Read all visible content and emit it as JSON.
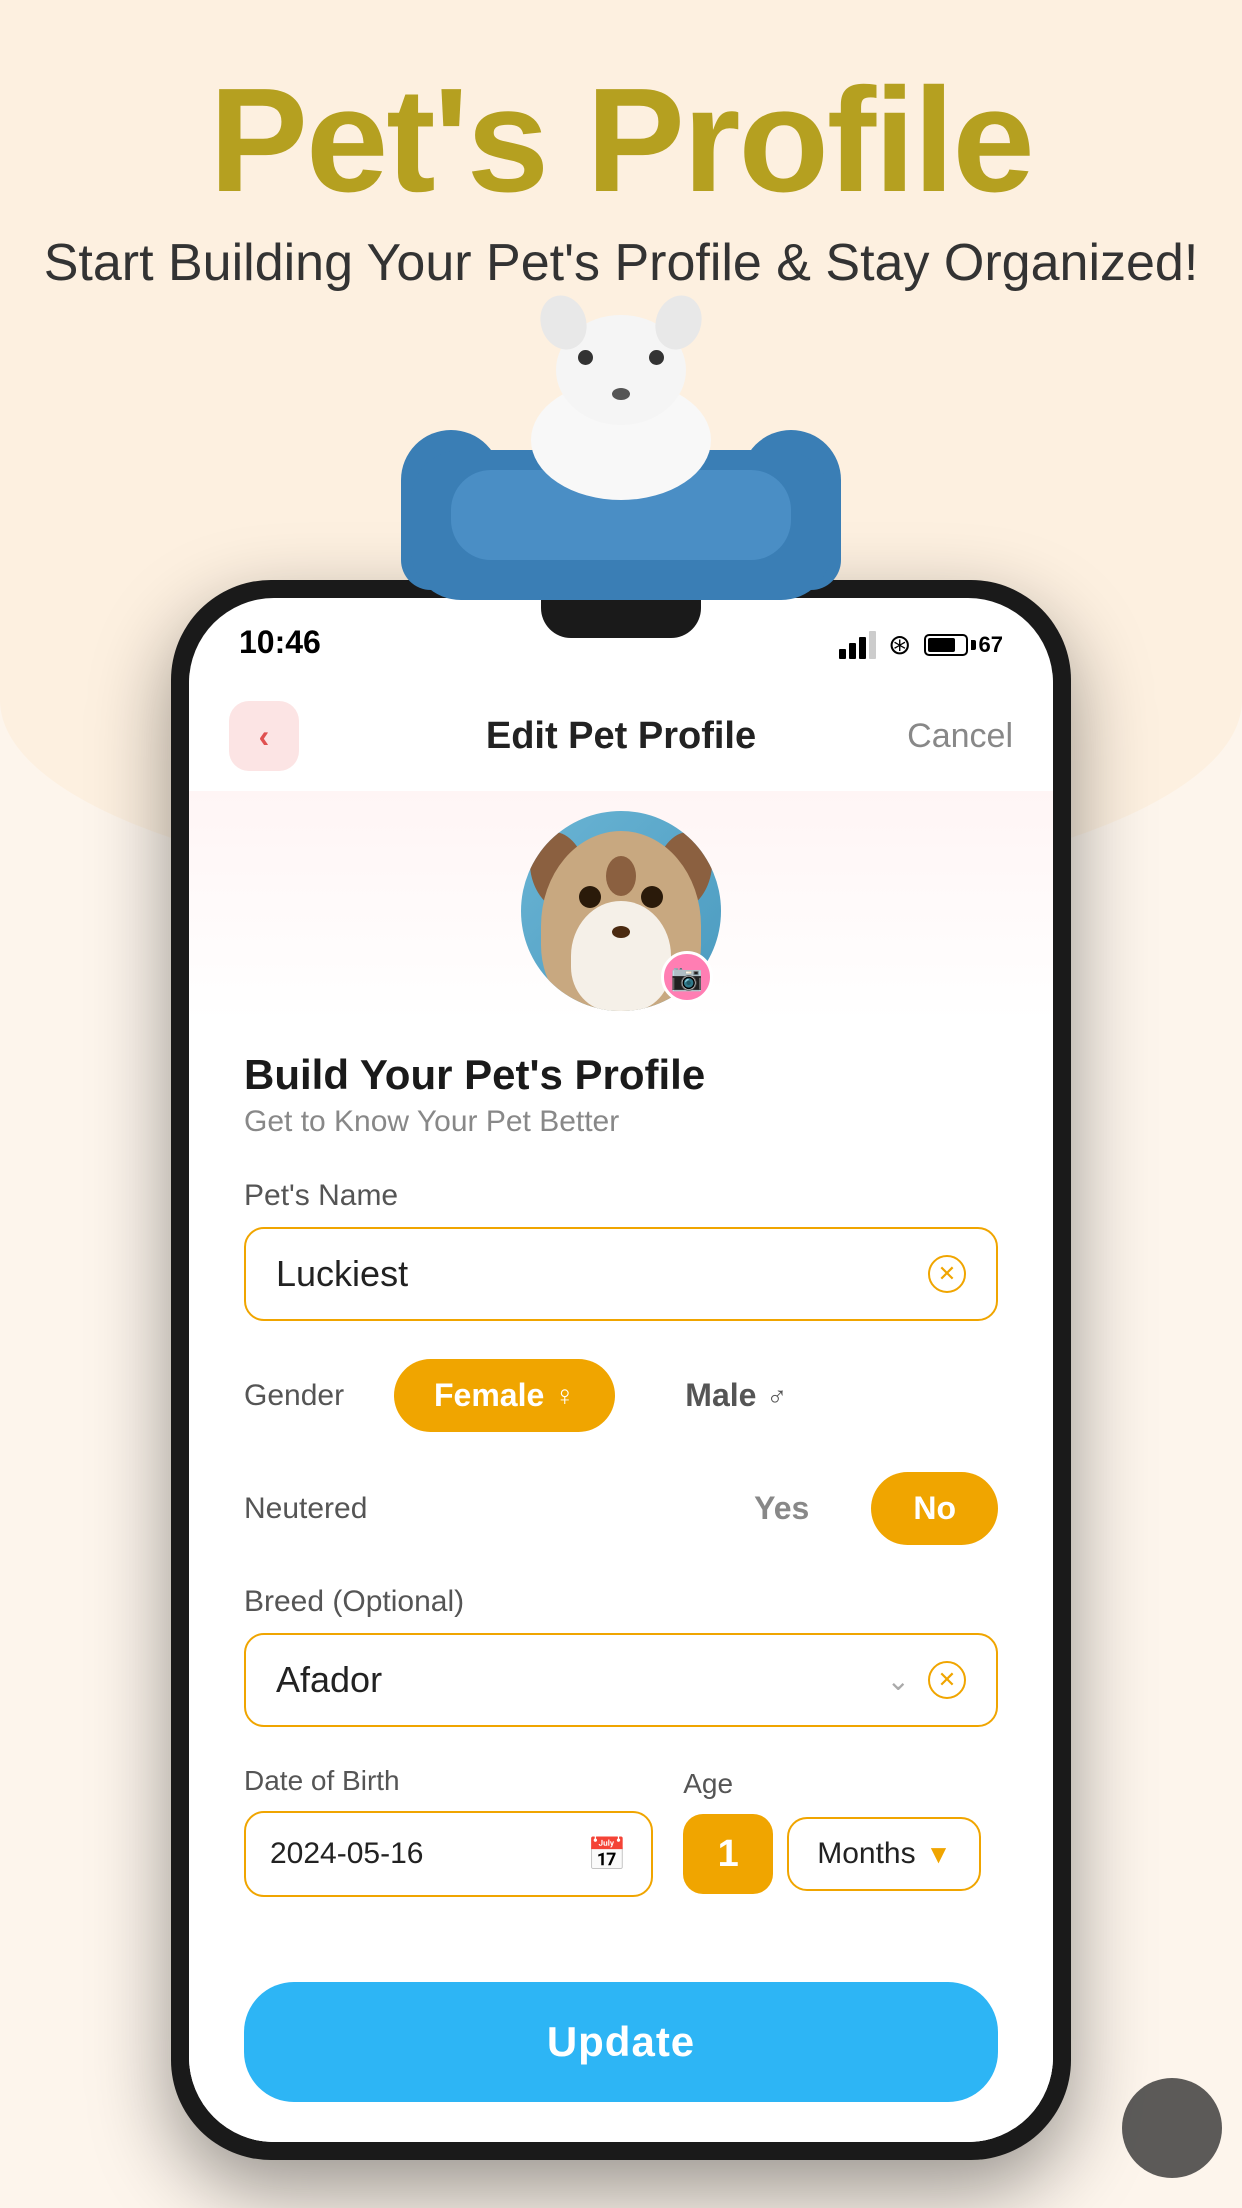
{
  "page": {
    "background_color": "#fdf0e0"
  },
  "header": {
    "main_title": "Pet's Profile",
    "sub_title": "Start Building Your Pet's Profile & Stay Organized!"
  },
  "status_bar": {
    "time": "10:46",
    "battery_label": "67"
  },
  "nav": {
    "title": "Edit Pet Profile",
    "cancel_label": "Cancel",
    "back_label": "‹"
  },
  "form": {
    "section_heading": "Build Your Pet's Profile",
    "section_sub": "Get to Know Your Pet Better",
    "pet_name_label": "Pet's Name",
    "pet_name_value": "Luckiest",
    "gender_label": "Gender",
    "gender_female": "Female",
    "gender_male": "Male",
    "gender_female_symbol": "♂",
    "gender_male_symbol": "♂",
    "gender_active": "Female",
    "neutered_label": "Neutered",
    "neutered_yes": "Yes",
    "neutered_no": "No",
    "neutered_active": "No",
    "breed_label": "Breed (Optional)",
    "breed_value": "Afador",
    "dob_label": "Date of Birth",
    "dob_value": "2024-05-16",
    "age_label": "Age",
    "age_number": "1",
    "age_unit": "Months",
    "update_btn": "Update"
  }
}
